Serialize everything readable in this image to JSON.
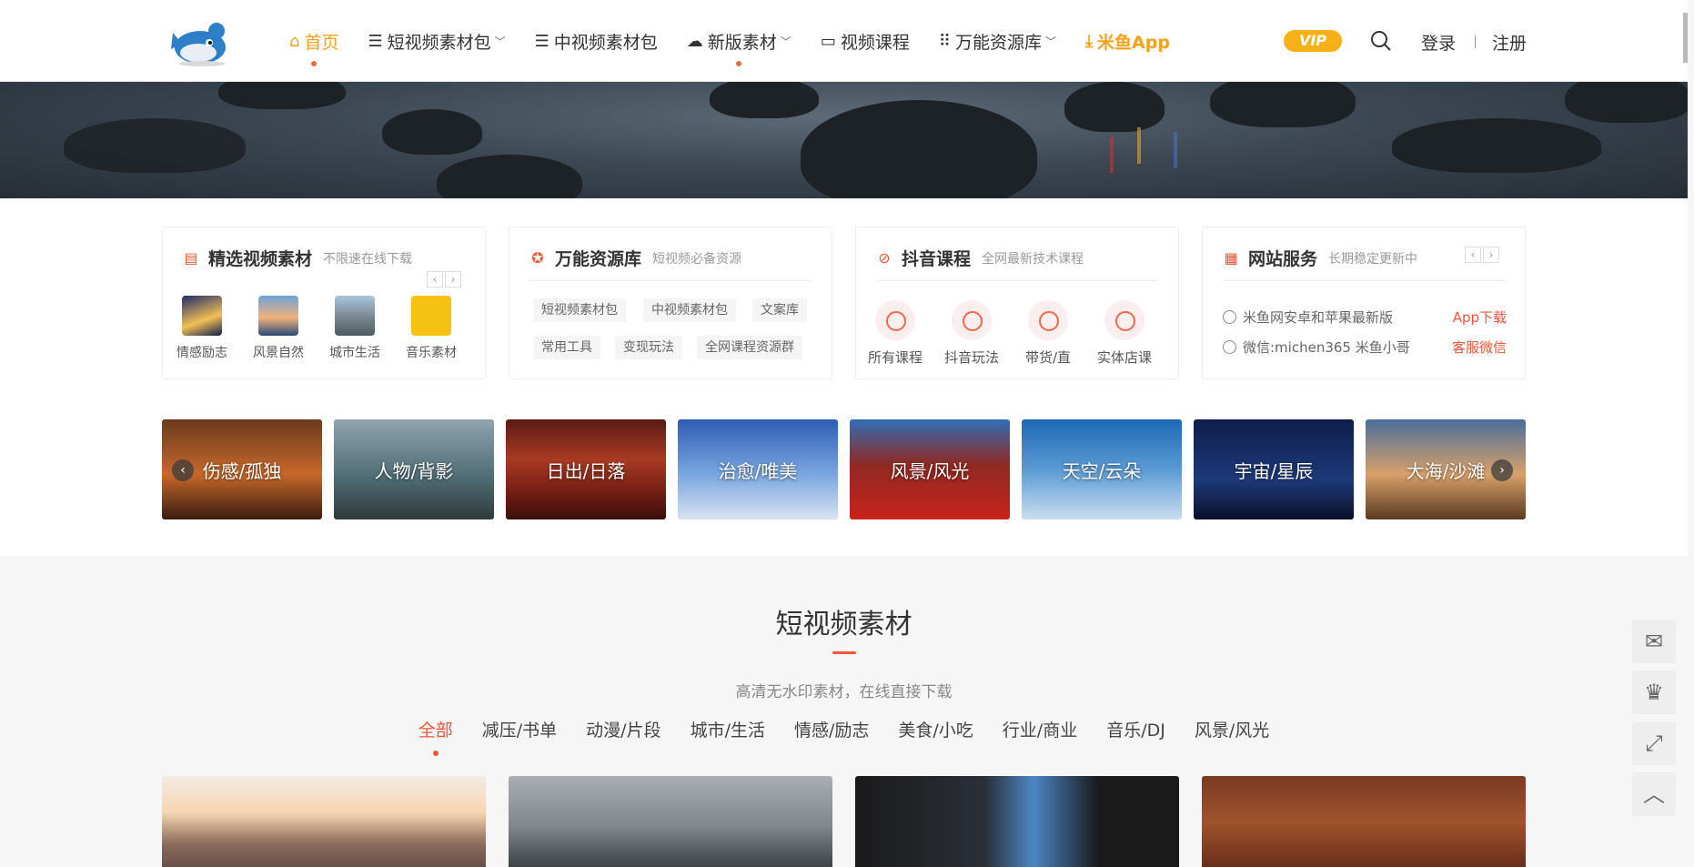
{
  "header": {
    "nav": [
      {
        "icon": "home-icon",
        "glyph": "⌂",
        "label": "首页",
        "active": true,
        "dot": true
      },
      {
        "icon": "list-icon",
        "glyph": "☰",
        "label": "短视频素材包",
        "caret": "﹀"
      },
      {
        "icon": "list-icon",
        "glyph": "☰",
        "label": "中视频素材包"
      },
      {
        "icon": "cloud-download-icon",
        "glyph": "☁",
        "label": "新版素材",
        "caret": "﹀",
        "dot": true
      },
      {
        "icon": "video-icon",
        "glyph": "▭",
        "label": "视频课程"
      },
      {
        "icon": "grid-icon",
        "glyph": "⠿",
        "label": "万能资源库",
        "caret": "﹀"
      },
      {
        "icon": "download-icon",
        "glyph": "⤓",
        "label": "米鱼App",
        "app": true
      }
    ],
    "vip": "VIP",
    "login": "登录",
    "register": "注册"
  },
  "cards": {
    "featured": {
      "title": "精选视频素材",
      "subtitle": "不限速在线下载",
      "items": [
        "情感励志",
        "风景自然",
        "城市生活",
        "音乐素材"
      ],
      "prev": "‹",
      "next": "›"
    },
    "resources": {
      "title": "万能资源库",
      "subtitle": "短视频必备资源",
      "tags": [
        "短视频素材包",
        "中视频素材包",
        "文案库",
        "常用工具",
        "变现玩法",
        "全网课程资源群"
      ]
    },
    "courses": {
      "title": "抖音课程",
      "subtitle": "全网最新技术课程",
      "items": [
        "所有课程",
        "抖音玩法",
        "带货/直",
        "实体店课"
      ]
    },
    "service": {
      "title": "网站服务",
      "subtitle": "长期稳定更新中",
      "prev": "‹",
      "next": "›",
      "rows": [
        {
          "text": "米鱼网安卓和苹果最新版",
          "action": "App下载"
        },
        {
          "text": "微信:michen365 米鱼小哥",
          "action": "客服微信"
        }
      ]
    }
  },
  "categories": [
    "伤感/孤独",
    "人物/背影",
    "日出/日落",
    "治愈/唯美",
    "风景/风光",
    "天空/云朵",
    "宇宙/星辰",
    "大海/沙滩"
  ],
  "strip_prev": "‹",
  "strip_next": "›",
  "section": {
    "title": "短视频素材",
    "subtitle": "高清无水印素材，在线直接下载",
    "filters": [
      "全部",
      "减压/书单",
      "动漫/片段",
      "城市/生活",
      "情感/励志",
      "美食/小吃",
      "行业/商业",
      "音乐/DJ",
      "风景/风光"
    ]
  },
  "tools": [
    "wechat-icon",
    "crown-icon",
    "fullscreen-icon",
    "back-to-top-icon"
  ],
  "colors": {
    "accent": "#f3a31b",
    "red": "#f0553b"
  }
}
